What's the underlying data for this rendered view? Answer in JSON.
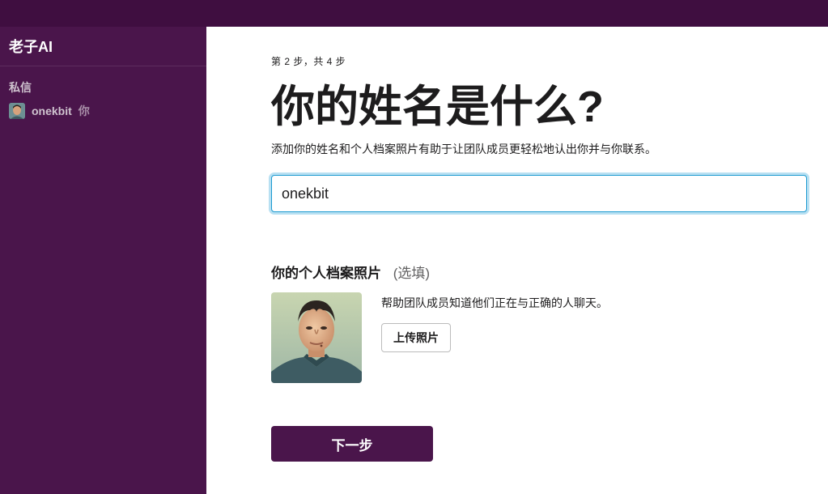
{
  "workspace": {
    "name": "老子AI"
  },
  "sidebar": {
    "section_title": "私信",
    "dm": {
      "name": "onekbit",
      "you_label": "你"
    }
  },
  "onboarding": {
    "step": "第 2 步，共 4 步",
    "title": "你的姓名是什么?",
    "description": "添加你的姓名和个人档案照片有助于让团队成员更轻松地认出你并与你联系。",
    "name_value": "onekbit",
    "photo_section": {
      "title": "你的个人档案照片",
      "optional": "(选填)",
      "help_text": "帮助团队成员知道他们正在与正确的人聊天。",
      "upload_label": "上传照片"
    },
    "next_label": "下一步"
  },
  "colors": {
    "sidebar_bg": "#4a154b",
    "topbar_bg": "#3f0e40",
    "focus_ring": "#1d9bd1"
  }
}
